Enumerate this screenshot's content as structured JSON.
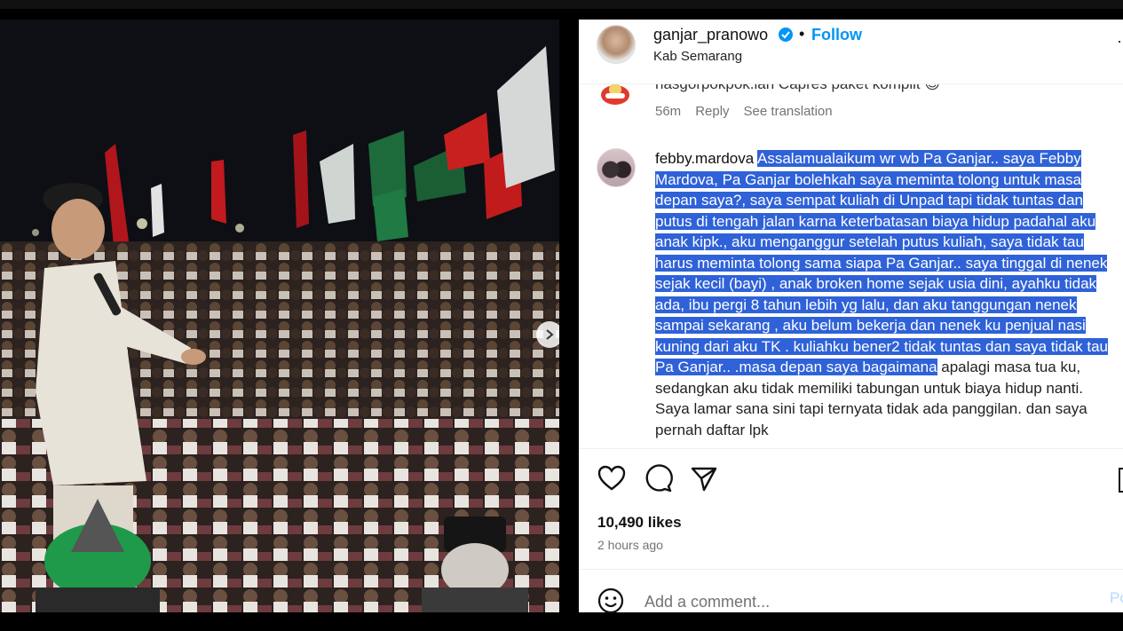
{
  "post": {
    "username": "ganjar_pranowo",
    "bullet": "•",
    "follow_label": "Follow",
    "location": "Kab Semarang",
    "more_label": "·"
  },
  "comments": [
    {
      "text": "nasgorpokpok.ian Capres paket komplit 😊",
      "time": "56m",
      "reply_label": "Reply",
      "translate_label": "See translation"
    },
    {
      "username": "febby.mardova",
      "highlighted_text": "Assalamualaikum wr wb Pa Ganjar.. saya Febby Mardova, Pa Ganjar bolehkah saya meminta tolong untuk masa depan saya?, saya sempat kuliah di Unpad tapi tidak tuntas dan putus di tengah jalan karna keterbatasan biaya hidup padahal aku anak kipk., aku menganggur setelah putus kuliah, saya tidak tau harus meminta tolong sama siapa Pa Ganjar.. saya tinggal di nenek sejak kecil (bayi) , anak broken home sejak usia dini, ayahku tidak ada, ibu pergi 8 tahun lebih yg lalu, dan aku tanggungan nenek sampai sekarang , aku belum bekerja dan nenek ku penjual nasi kuning dari aku TK . kuliahku bener2 tidak tuntas dan saya tidak tau Pa Ganjar.. .masa depan saya bagaimana",
      "rest_text": " apalagi masa tua ku, sedangkan aku tidak memiliki tabungan untuk biaya hidup nanti. Saya lamar sana sini tapi ternyata tidak ada panggilan. dan saya pernah daftar lpk"
    }
  ],
  "stats": {
    "likes": "10,490 likes",
    "time_ago": "2 hours ago"
  },
  "composer": {
    "placeholder": "Add a comment...",
    "post_label": "Po"
  },
  "icons": {
    "like": "heart-icon",
    "comment": "comment-icon",
    "share": "paper-plane-icon",
    "save": "bookmark-icon",
    "emoji": "smiley-icon",
    "next": "chevron-right-icon",
    "verified": "verified-badge-icon"
  },
  "colors": {
    "accent": "#0095f6",
    "selection": "#2f62d8",
    "muted": "#737373"
  },
  "carousel": {
    "total_slides": 6,
    "active_slide": 1
  }
}
